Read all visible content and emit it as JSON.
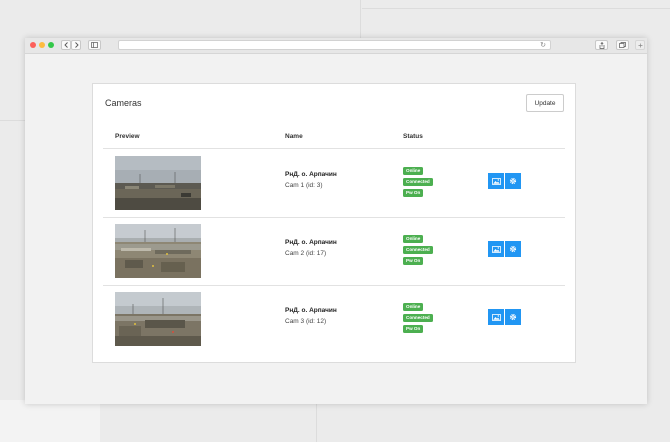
{
  "cameras_panel": {
    "title": "Cameras",
    "update_label": "Update",
    "columns": {
      "preview": "Preview",
      "name": "Name",
      "status": "Status"
    },
    "rows": [
      {
        "name": "РнД. о. Арпачин",
        "camera": "Cam 1 (id: 3)",
        "statuses": [
          "Online",
          "Connected",
          "Pw On"
        ]
      },
      {
        "name": "РнД. о. Арпачин",
        "camera": "Cam 2 (id: 17)",
        "statuses": [
          "Online",
          "Connected",
          "Pw On"
        ]
      },
      {
        "name": "РнД. о. Арпачин",
        "camera": "Cam 3 (id: 12)",
        "statuses": [
          "Online",
          "Connected",
          "Pw On"
        ]
      }
    ],
    "status_color": "#4caf50",
    "action_color": "#2196f3",
    "action_icons": [
      "image-icon",
      "gear-icon"
    ]
  }
}
